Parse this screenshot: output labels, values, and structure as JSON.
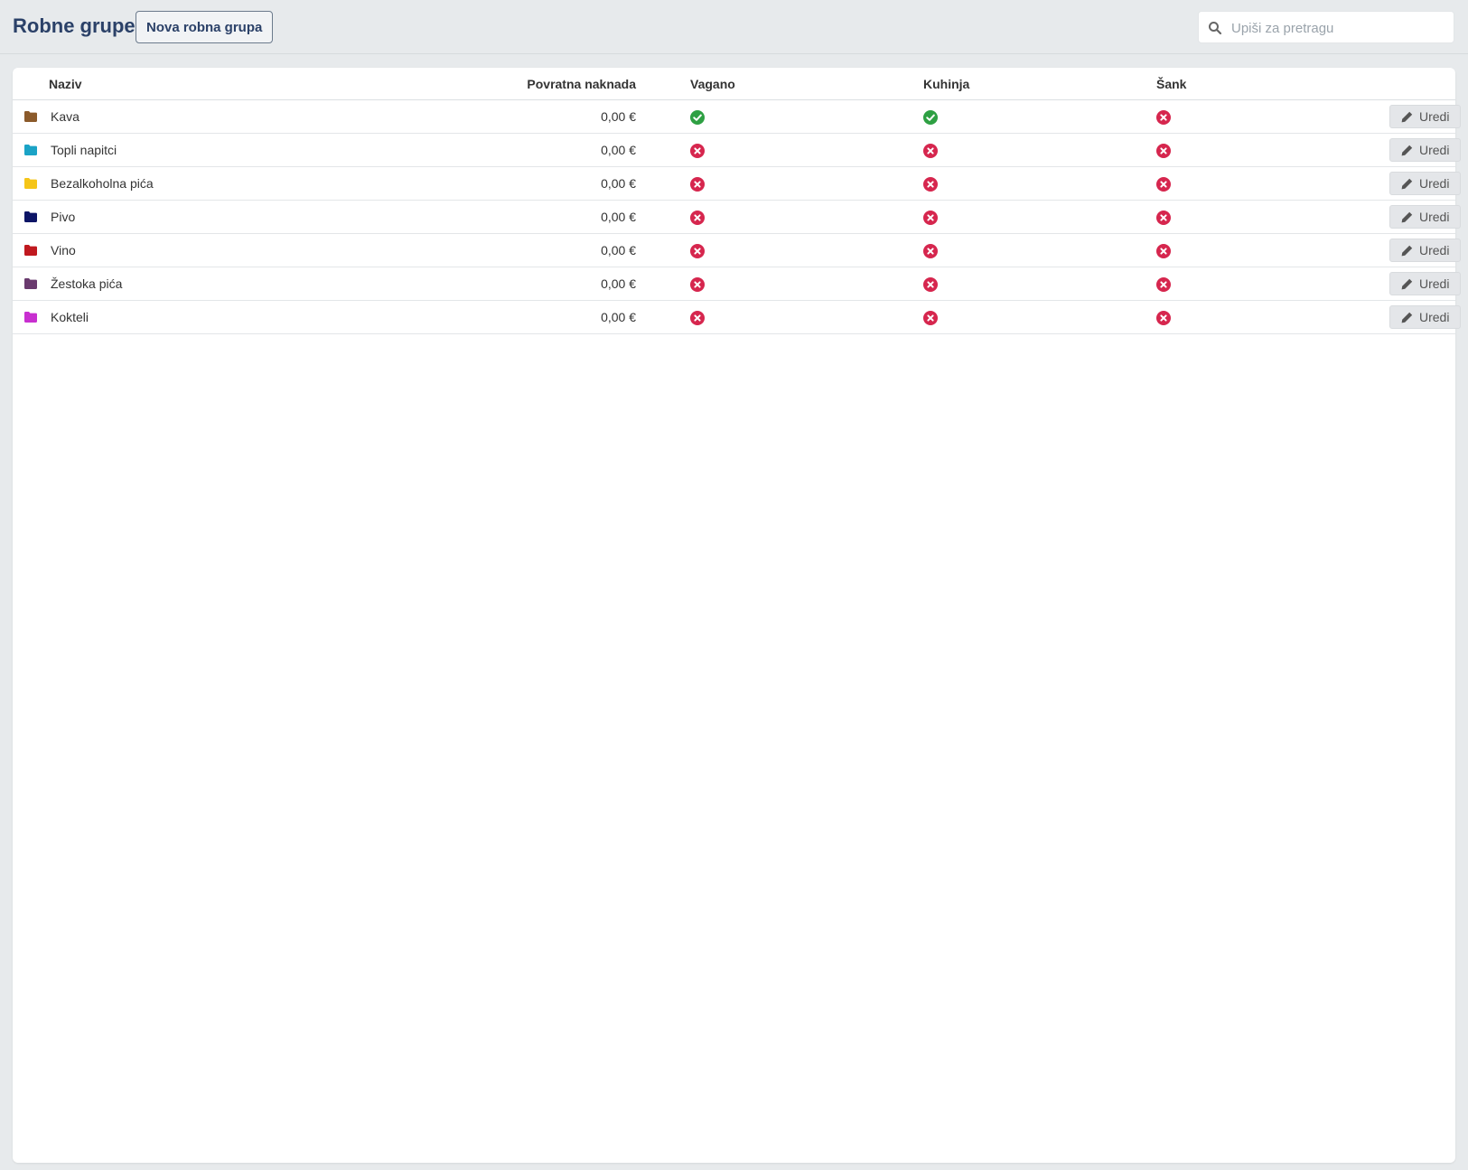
{
  "header": {
    "title": "Robne grupe",
    "new_button_label": "Nova robna grupa",
    "search_placeholder": "Upiši za pretragu"
  },
  "table": {
    "columns": {
      "name": "Naziv",
      "fee": "Povratna naknada",
      "weighed": "Vagano",
      "kitchen": "Kuhinja",
      "bar": "Šank"
    },
    "edit_label": "Uredi",
    "rows": [
      {
        "name": "Kava",
        "fee": "0,00 €",
        "color": "#8b5a2b",
        "weighed": true,
        "kitchen": true,
        "bar": false
      },
      {
        "name": "Topli napitci",
        "fee": "0,00 €",
        "color": "#1ba3c6",
        "weighed": false,
        "kitchen": false,
        "bar": false
      },
      {
        "name": "Bezalkoholna pića",
        "fee": "0,00 €",
        "color": "#f5c518",
        "weighed": false,
        "kitchen": false,
        "bar": false
      },
      {
        "name": "Pivo",
        "fee": "0,00 €",
        "color": "#0d1566",
        "weighed": false,
        "kitchen": false,
        "bar": false
      },
      {
        "name": "Vino",
        "fee": "0,00 €",
        "color": "#c0191f",
        "weighed": false,
        "kitchen": false,
        "bar": false
      },
      {
        "name": "Žestoka pića",
        "fee": "0,00 €",
        "color": "#6a3a6e",
        "weighed": false,
        "kitchen": false,
        "bar": false
      },
      {
        "name": "Kokteli",
        "fee": "0,00 €",
        "color": "#c82fd0",
        "weighed": false,
        "kitchen": false,
        "bar": false
      }
    ]
  },
  "colors": {
    "yes": "#2ea043",
    "no": "#d6264e"
  }
}
